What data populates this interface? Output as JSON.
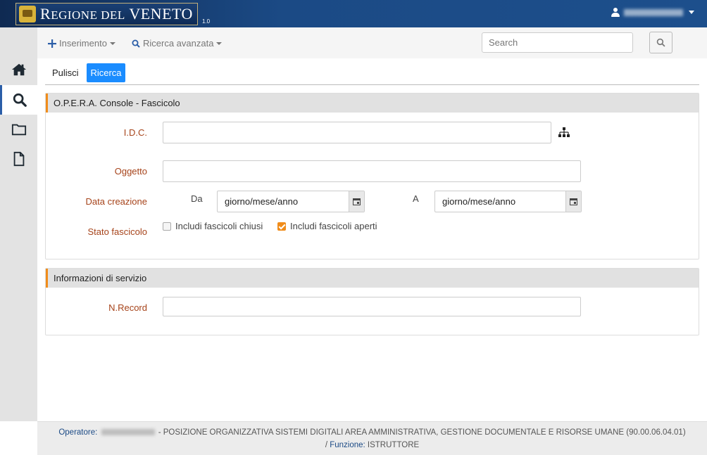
{
  "header": {
    "logo_text_big1": "R",
    "logo_text_mid1": "EGIONE ",
    "logo_text_big2": "",
    "logo_text_small": "DEL",
    "logo_text_main2": " VENETO",
    "version": "1.0",
    "user_name": ""
  },
  "sidebar": {
    "items": [
      {
        "name": "home"
      },
      {
        "name": "search",
        "active": true
      },
      {
        "name": "folder"
      },
      {
        "name": "document"
      }
    ]
  },
  "toolbar": {
    "insert_label": "Inserimento",
    "advanced_search_label": "Ricerca avanzata",
    "search_placeholder": "Search"
  },
  "actions": {
    "clear_label": "Pulisci",
    "search_label": "Ricerca"
  },
  "panel_fascicolo": {
    "title": "O.P.E.R.A. Console - Fascicolo",
    "idc_label": "I.D.C.",
    "idc_value": "",
    "oggetto_label": "Oggetto",
    "oggetto_value": "",
    "data_creazione_label": "Data creazione",
    "da_label": "Da",
    "a_label": "A",
    "date_from_placeholder": "giorno/mese/anno",
    "date_to_placeholder": "giorno/mese/anno",
    "stato_label": "Stato fascicolo",
    "chk_chiusi_label": "Includi fascicoli chiusi",
    "chk_chiusi_checked": false,
    "chk_aperti_label": "Includi fascicoli aperti",
    "chk_aperti_checked": true
  },
  "panel_servizio": {
    "title": "Informazioni di servizio",
    "nrecord_label": "N.Record",
    "nrecord_value": ""
  },
  "footer": {
    "operatore_key": "Operatore:",
    "operatore_desc": " - POSIZIONE ORGANIZZATIVA SISTEMI DIGITALI AREA AMMINISTRATIVA, GESTIONE DOCUMENTALE E RISORSE UMANE (90.00.06.04.01)",
    "separator": "/ ",
    "funzione_key": "Funzione:",
    "funzione_value": " ISTRUTTORE"
  },
  "colors": {
    "header_blue": "#1b4a85",
    "label_red": "#a6431a",
    "accent_orange": "#f08c1a",
    "primary_button": "#1a8cff"
  }
}
